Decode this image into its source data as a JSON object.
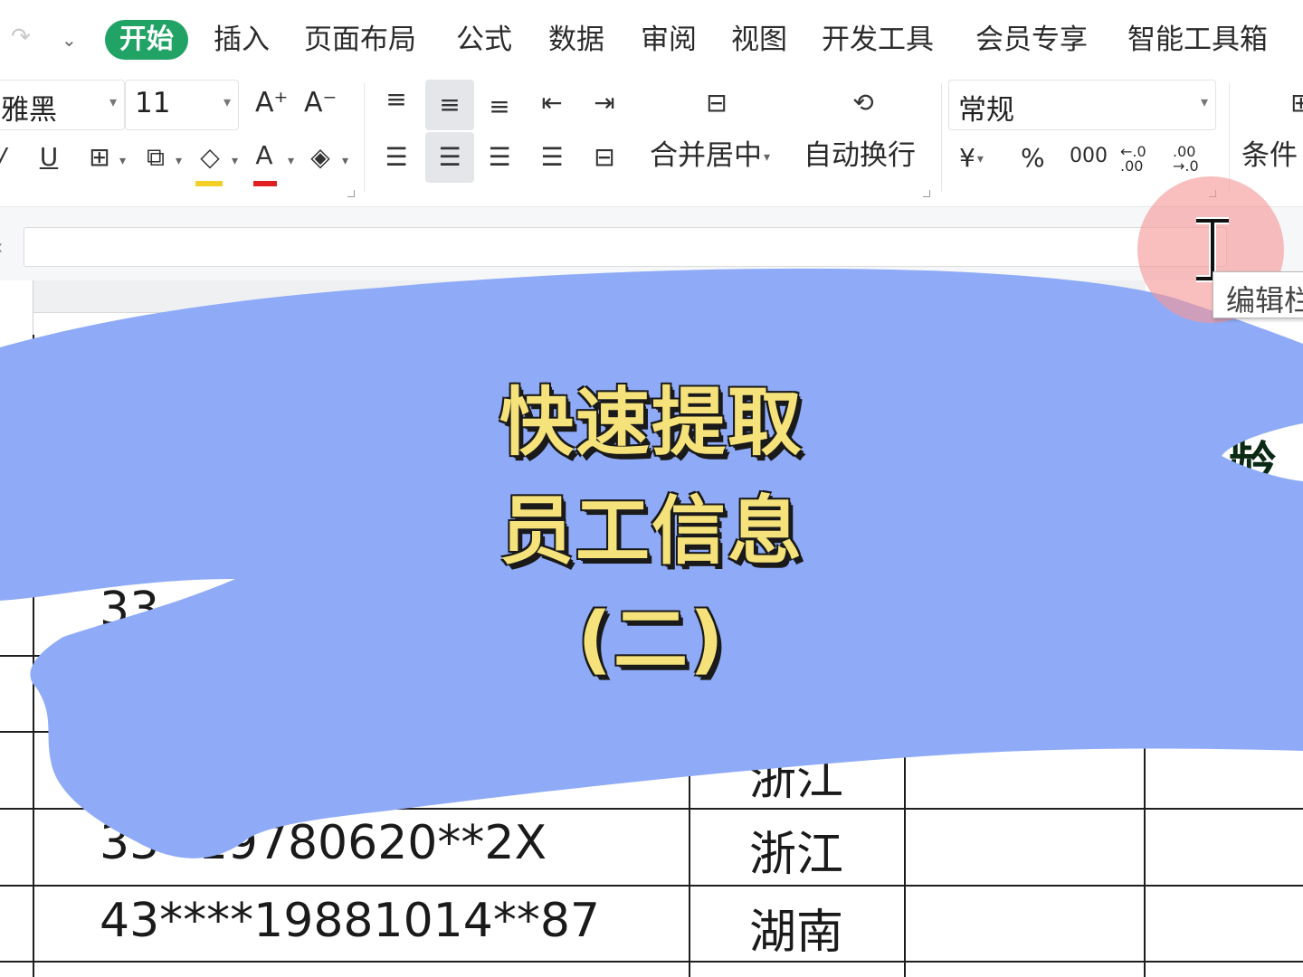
{
  "quick_access": {
    "redo_icon": "redo-icon",
    "more_icon": "chevron-down-icon"
  },
  "menu": {
    "tabs": [
      "开始",
      "插入",
      "页面布局",
      "公式",
      "数据",
      "审阅",
      "视图",
      "开发工具",
      "会员专享",
      "智能工具箱"
    ],
    "active_tab": "开始",
    "active_color": "#21a366"
  },
  "ribbon": {
    "font_name": "雅黑",
    "font_size": "11",
    "grow_font": "A⁺",
    "shrink_font": "A⁻",
    "merge_center": "合并居中",
    "wrap_text": "自动换行",
    "number_format": "常规",
    "currency": "¥",
    "percent": "%",
    "thousands": "000",
    "inc_decimal": "←.0 .00",
    "dec_decimal": ".00 →.0",
    "conditional": "条件"
  },
  "sheet": {
    "rows": [
      {
        "id": "33",
        "place": ""
      },
      {
        "id": "",
        "place": "浙江"
      },
      {
        "id": "33*    19780620**2X",
        "place": "浙江"
      },
      {
        "id": "43****19881014**87",
        "place": "湖南"
      }
    ],
    "header_fragment": "年龄",
    "header_color": "#22a25a"
  },
  "overlay": {
    "title_line1": "快速提取",
    "title_line2": "员工信息",
    "title_line3": "(二)",
    "paint_color": "#8fabf7",
    "text_color": "#f5e27a"
  },
  "cursor": {
    "tooltip": "编辑栏"
  }
}
